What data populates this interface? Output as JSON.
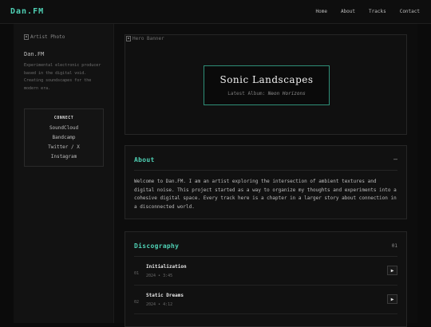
{
  "header": {
    "brand": "Dan.FM",
    "nav": [
      "Home",
      "About",
      "Tracks",
      "Contact"
    ]
  },
  "sidebar": {
    "photo_alt": "Artist Photo",
    "name": "Dan.FM",
    "bio": "Experimental electronic producer based in the digital void. Creating soundscapes for the modern era.",
    "connect_title": "CONNECT",
    "links": [
      "SoundCloud",
      "Bandcamp",
      "Twitter / X",
      "Instagram"
    ]
  },
  "hero": {
    "image_alt": "Hero Banner",
    "title": "Sonic Landscapes",
    "subtitle_prefix": "Latest Album: ",
    "album": "Neon Horizons"
  },
  "about": {
    "title": "About",
    "toggle": "–",
    "text": "Welcome to Dan.FM. I am an artist exploring the intersection of ambient textures and digital noise. This project started as a way to organize my thoughts and experiments into a cohesive digital space. Every track here is a chapter in a larger story about connection in a disconnected world."
  },
  "discography": {
    "title": "Discography",
    "count": "01",
    "tracks": [
      {
        "num": "01",
        "title": "Initialization",
        "year": "2024",
        "duration": "3:45",
        "play": "▶"
      },
      {
        "num": "02",
        "title": "Static Dreams",
        "year": "2024",
        "duration": "4:12",
        "play": "▶"
      }
    ]
  },
  "colors": {
    "accent": "#4fd1b5",
    "background": "#0b0b0b",
    "panel": "#111111"
  }
}
